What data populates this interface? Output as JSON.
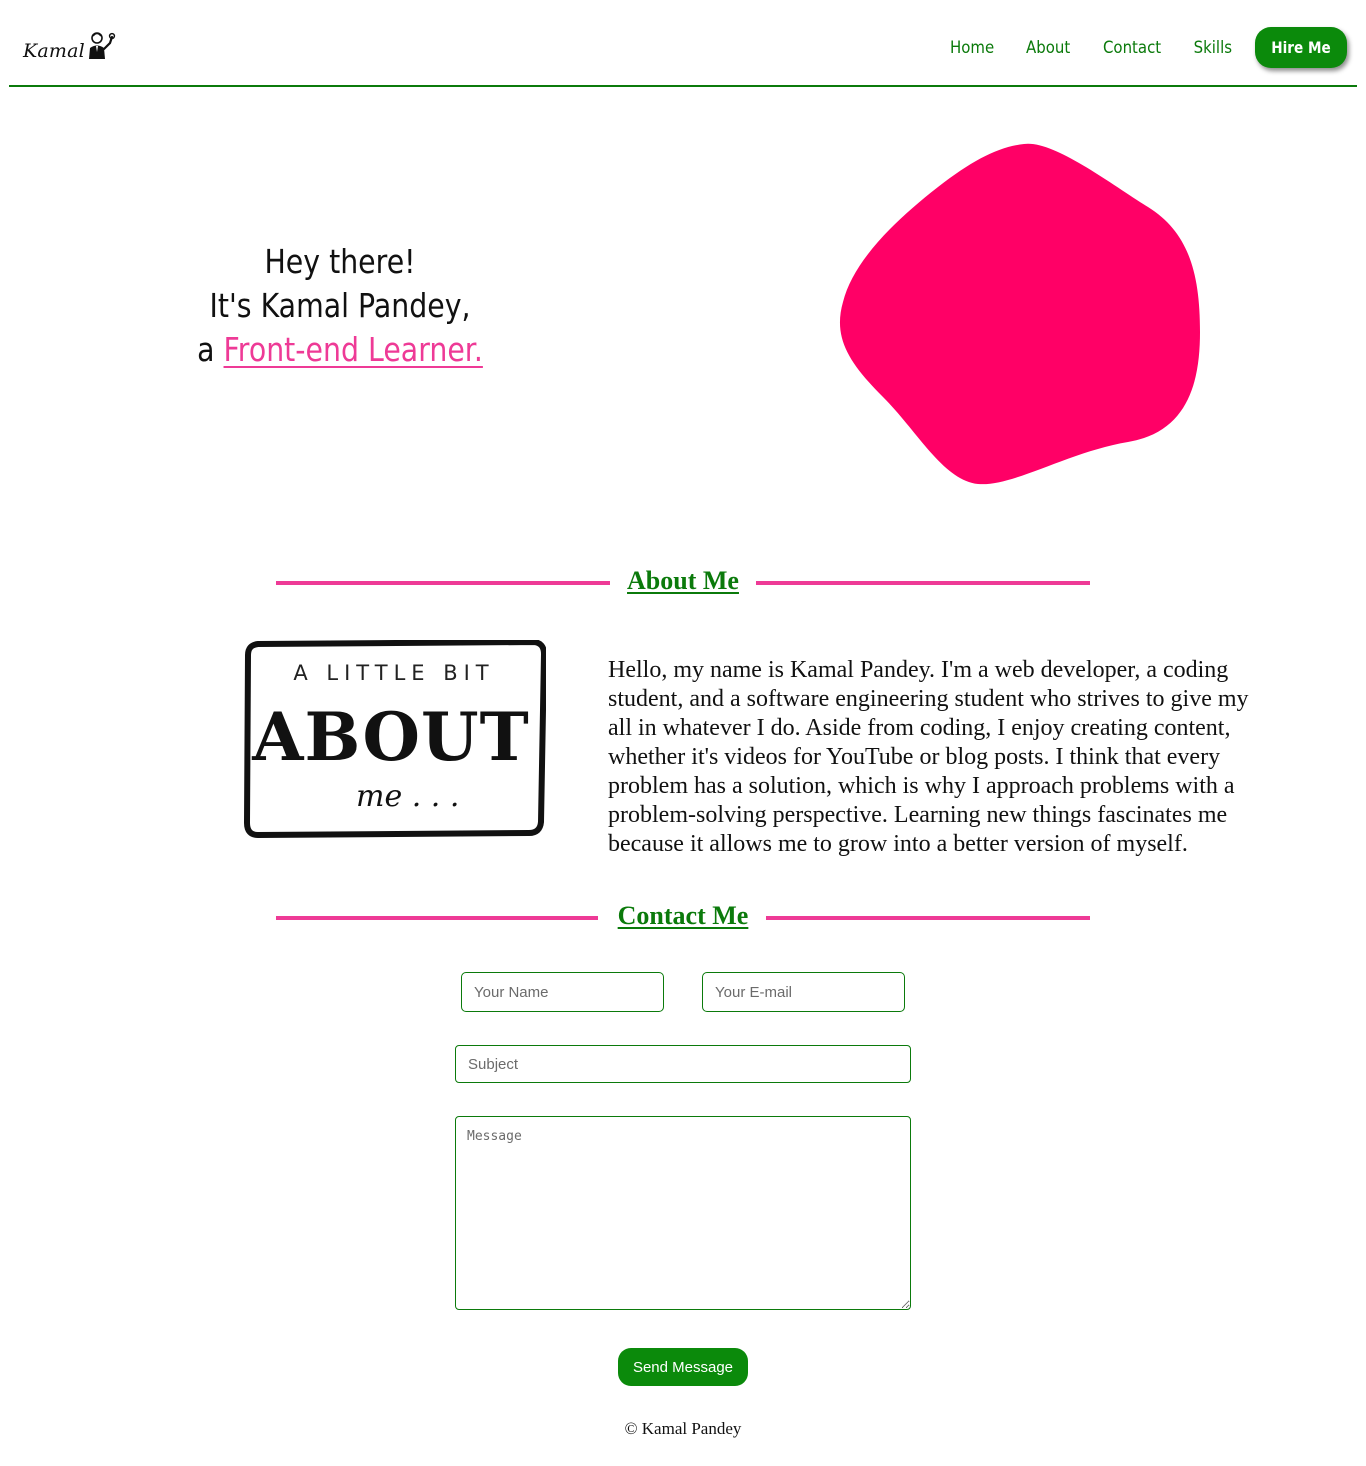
{
  "header": {
    "logo_text": "Kamal",
    "nav": [
      {
        "label": "Home"
      },
      {
        "label": "About"
      },
      {
        "label": "Contact"
      },
      {
        "label": "Skills"
      }
    ],
    "hire_label": "Hire Me"
  },
  "hero": {
    "line1": "Hey there!",
    "line2": "It's Kamal Pandey,",
    "line3_prefix": "a ",
    "role": "Front-end Learner."
  },
  "about": {
    "title": "About Me",
    "image_text": {
      "top": "A LITTLE BIT",
      "main": "ABOUT",
      "bottom": "me . . ."
    },
    "paragraph": "Hello, my name is Kamal Pandey. I'm a web developer, a coding student, and a software engineering student who strives to give my all in whatever I do. Aside from coding, I enjoy creating content, whether it's videos for YouTube or blog posts. I think that every problem has a solution, which is why I approach problems with a problem-solving perspective. Learning new things fascinates me because it allows me to grow into a better version of myself."
  },
  "contact": {
    "title": "Contact Me",
    "name_placeholder": "Your Name",
    "email_placeholder": "Your E-mail",
    "subject_placeholder": "Subject",
    "message_placeholder": "Message",
    "send_label": "Send Message"
  },
  "footer": {
    "copyright": "© Kamal Pandey"
  },
  "colors": {
    "brand_green": "#0b7a0b",
    "accent_pink": "#ee3a96",
    "blob_pink": "#ff0066"
  }
}
